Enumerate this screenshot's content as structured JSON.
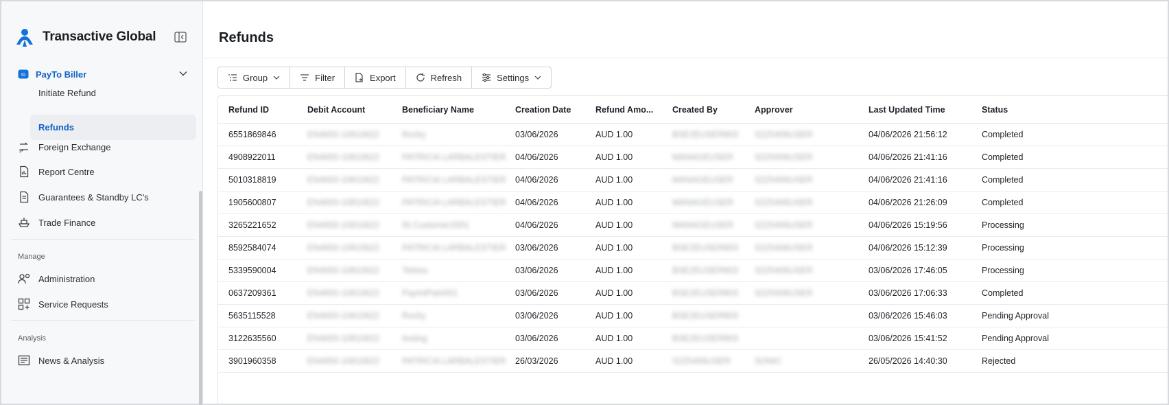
{
  "app": {
    "name": "Transactive Global"
  },
  "sidebar": {
    "group": {
      "label": "PayTo Biller"
    },
    "sub_items": [
      {
        "label": "Initiate Refund"
      },
      {
        "label": "Refunds"
      }
    ],
    "items": [
      {
        "label": "Foreign Exchange",
        "icon": "exchange-icon"
      },
      {
        "label": "Report Centre",
        "icon": "report-icon"
      },
      {
        "label": "Guarantees & Standby LC's",
        "icon": "document-icon"
      },
      {
        "label": "Trade Finance",
        "icon": "ship-icon"
      }
    ],
    "manage_title": "Manage",
    "manage_items": [
      {
        "label": "Administration",
        "icon": "admin-icon"
      },
      {
        "label": "Service Requests",
        "icon": "grid-plus-icon"
      }
    ],
    "analysis_title": "Analysis",
    "analysis_items": [
      {
        "label": "News & Analysis",
        "icon": "news-icon"
      }
    ]
  },
  "page": {
    "title": "Refunds"
  },
  "toolbar": {
    "group": "Group",
    "filter": "Filter",
    "export": "Export",
    "refresh": "Refresh",
    "settings": "Settings"
  },
  "table": {
    "columns": [
      "Refund ID",
      "Debit Account",
      "Beneficiary Name",
      "Creation Date",
      "Refund Amo...",
      "Created By",
      "Approver",
      "Last Updated Time",
      "Status"
    ],
    "rows": [
      {
        "id": "6551869846",
        "debit": "EN4650-10810622",
        "beneficiary": "Rocky",
        "created": "03/06/2026",
        "amount": "AUD 1.00",
        "created_by": "BSE2EUSER803",
        "approver": "S225406USER",
        "updated": "04/06/2026 21:56:12",
        "status": "Completed"
      },
      {
        "id": "4908922011",
        "debit": "EN4650-10810622",
        "beneficiary": "PATRICIA LARBALESTIER",
        "created": "04/06/2026",
        "amount": "AUD 1.00",
        "created_by": "MANAGEUSER",
        "approver": "S225406USER",
        "updated": "04/06/2026 21:41:16",
        "status": "Completed"
      },
      {
        "id": "5010318819",
        "debit": "EN4650-10810622",
        "beneficiary": "PATRICIA LARBALESTIER",
        "created": "04/06/2026",
        "amount": "AUD 1.00",
        "created_by": "MANAGEUSER",
        "approver": "S225406USER",
        "updated": "04/06/2026 21:41:16",
        "status": "Completed"
      },
      {
        "id": "1905600807",
        "debit": "EN4650-10810622",
        "beneficiary": "PATRICIA LARBALESTIER",
        "created": "04/06/2026",
        "amount": "AUD 1.00",
        "created_by": "MANAGEUSER",
        "approver": "S225406USER",
        "updated": "04/06/2026 21:26:09",
        "status": "Completed"
      },
      {
        "id": "3265221652",
        "debit": "EN4650-10810622",
        "beneficiary": "IN Customer2001",
        "created": "04/06/2026",
        "amount": "AUD 1.00",
        "created_by": "MANAGEUSER",
        "approver": "S225406USER",
        "updated": "04/06/2026 15:19:56",
        "status": "Processing"
      },
      {
        "id": "8592584074",
        "debit": "EN4650-10810622",
        "beneficiary": "PATRICIA LARBALESTIER",
        "created": "03/06/2026",
        "amount": "AUD 1.00",
        "created_by": "BSE2EUSER803",
        "approver": "S225406USER",
        "updated": "04/06/2026 15:12:39",
        "status": "Processing"
      },
      {
        "id": "5339590004",
        "debit": "EN4650-10810622",
        "beneficiary": "Telstra",
        "created": "03/06/2026",
        "amount": "AUD 1.00",
        "created_by": "BSE2EUSER803",
        "approver": "S225406USER",
        "updated": "03/06/2026 17:46:05",
        "status": "Processing"
      },
      {
        "id": "0637209361",
        "debit": "EN4650-10810622",
        "beneficiary": "PayIntPain001",
        "created": "03/06/2026",
        "amount": "AUD 1.00",
        "created_by": "BSE2EUSER803",
        "approver": "S225406USER",
        "updated": "03/06/2026 17:06:33",
        "status": "Completed"
      },
      {
        "id": "5635115528",
        "debit": "EN4650-10810622",
        "beneficiary": "Rocky",
        "created": "03/06/2026",
        "amount": "AUD 1.00",
        "created_by": "BSE2EUSER803",
        "approver": "",
        "updated": "03/06/2026 15:46:03",
        "status": "Pending Approval"
      },
      {
        "id": "3122635560",
        "debit": "EN4650-10810622",
        "beneficiary": "testing",
        "created": "03/06/2026",
        "amount": "AUD 1.00",
        "created_by": "BSE2EUSER803",
        "approver": "",
        "updated": "03/06/2026 15:41:52",
        "status": "Pending Approval"
      },
      {
        "id": "3901960358",
        "debit": "EN4650-10810622",
        "beneficiary": "PATRICIA LARBALESTIER",
        "created": "26/03/2026",
        "amount": "AUD 1.00",
        "created_by": "S225406USER",
        "approver": "SONIC",
        "updated": "26/05/2026 14:40:30",
        "status": "Rejected"
      }
    ]
  },
  "colors": {
    "accent": "#1363c7",
    "sidebar_bg": "#f7f8f9",
    "active_bg": "#eceef1"
  }
}
